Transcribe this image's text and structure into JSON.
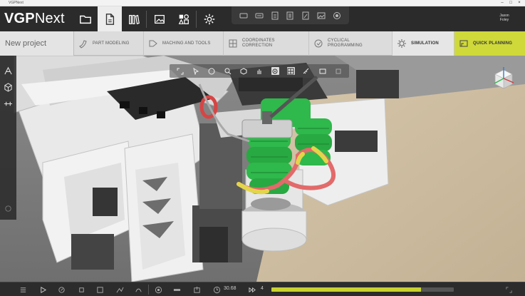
{
  "window": {
    "title": "VGPNext"
  },
  "app": {
    "logo_bold": "VGP",
    "logo_light": "Next"
  },
  "toolbar": {
    "buttons": [
      {
        "name": "open-folder",
        "icon": "folder-icon"
      },
      {
        "name": "new-document",
        "icon": "document-icon",
        "active": true
      },
      {
        "name": "library",
        "icon": "books-icon"
      },
      {
        "name": "image",
        "icon": "image-icon"
      },
      {
        "name": "layout",
        "icon": "shapes-icon"
      },
      {
        "name": "settings",
        "icon": "gear-icon"
      }
    ],
    "quick_tools": [
      "cut-icon",
      "copy-icon",
      "paste-icon",
      "document-icon",
      "edit-icon",
      "image-icon",
      "record-icon"
    ]
  },
  "user": {
    "line1": "Jason",
    "line2": "Foley"
  },
  "workflow": {
    "project_name": "New project",
    "steps": [
      {
        "id": "part-modeling",
        "line1": "Part modeling",
        "line2": ""
      },
      {
        "id": "maching-tools",
        "line1": "Maching and tools",
        "line2": ""
      },
      {
        "id": "coordinates-correction",
        "line1": "Coordinates",
        "line2": "correction"
      },
      {
        "id": "cyclical-programming",
        "line1": "Cyclical",
        "line2": "programming"
      },
      {
        "id": "simulation",
        "line1": "Simulation",
        "line2": ""
      },
      {
        "id": "quick-planning",
        "line1": "Quick planning",
        "line2": ""
      }
    ]
  },
  "timeline": {
    "time_value": "30.68",
    "step_value": "4",
    "progress": 0.82
  },
  "colors": {
    "accent": "#cfd93a",
    "bender_green": "#2fb84b",
    "tube_red": "#e26a6a",
    "tube_yellow": "#e3d54a",
    "floor": "#c9b79c"
  }
}
